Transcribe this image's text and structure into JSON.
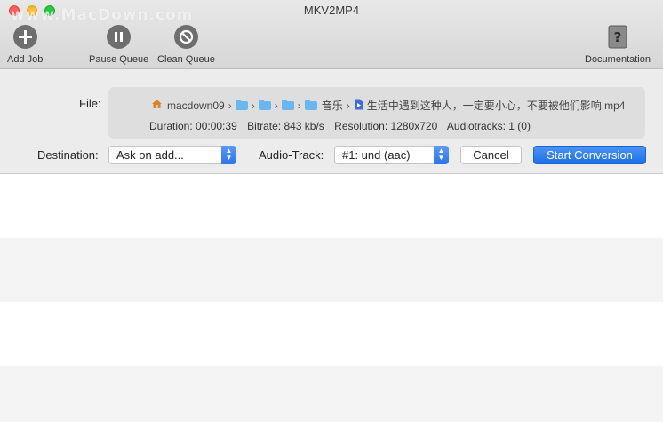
{
  "window": {
    "title": "MKV2MP4",
    "watermark": "www.MacDown.com"
  },
  "toolbar": {
    "add_job": "Add Job",
    "pause_queue": "Pause Queue",
    "clean_queue": "Clean Queue",
    "documentation": "Documentation"
  },
  "file": {
    "label": "File:",
    "path": {
      "home": "macdown09",
      "music_folder": "音乐",
      "filename": "生活中遇到这种人，一定要小心，不要被他们影响.mp4",
      "separator": "›"
    },
    "info": {
      "duration": "Duration: 00:00:39",
      "bitrate": "Bitrate: 843 kb/s",
      "resolution": "Resolution: 1280x720",
      "audiotracks": "Audiotracks: 1 (0)"
    }
  },
  "controls": {
    "destination_label": "Destination:",
    "destination_value": "Ask on add...",
    "audio_track_label": "Audio-Track:",
    "audio_track_value": "#1: und (aac)",
    "cancel": "Cancel",
    "start": "Start Conversion"
  },
  "colors": {
    "accent": "#2f74e8",
    "folder": "#6cb6ef"
  }
}
